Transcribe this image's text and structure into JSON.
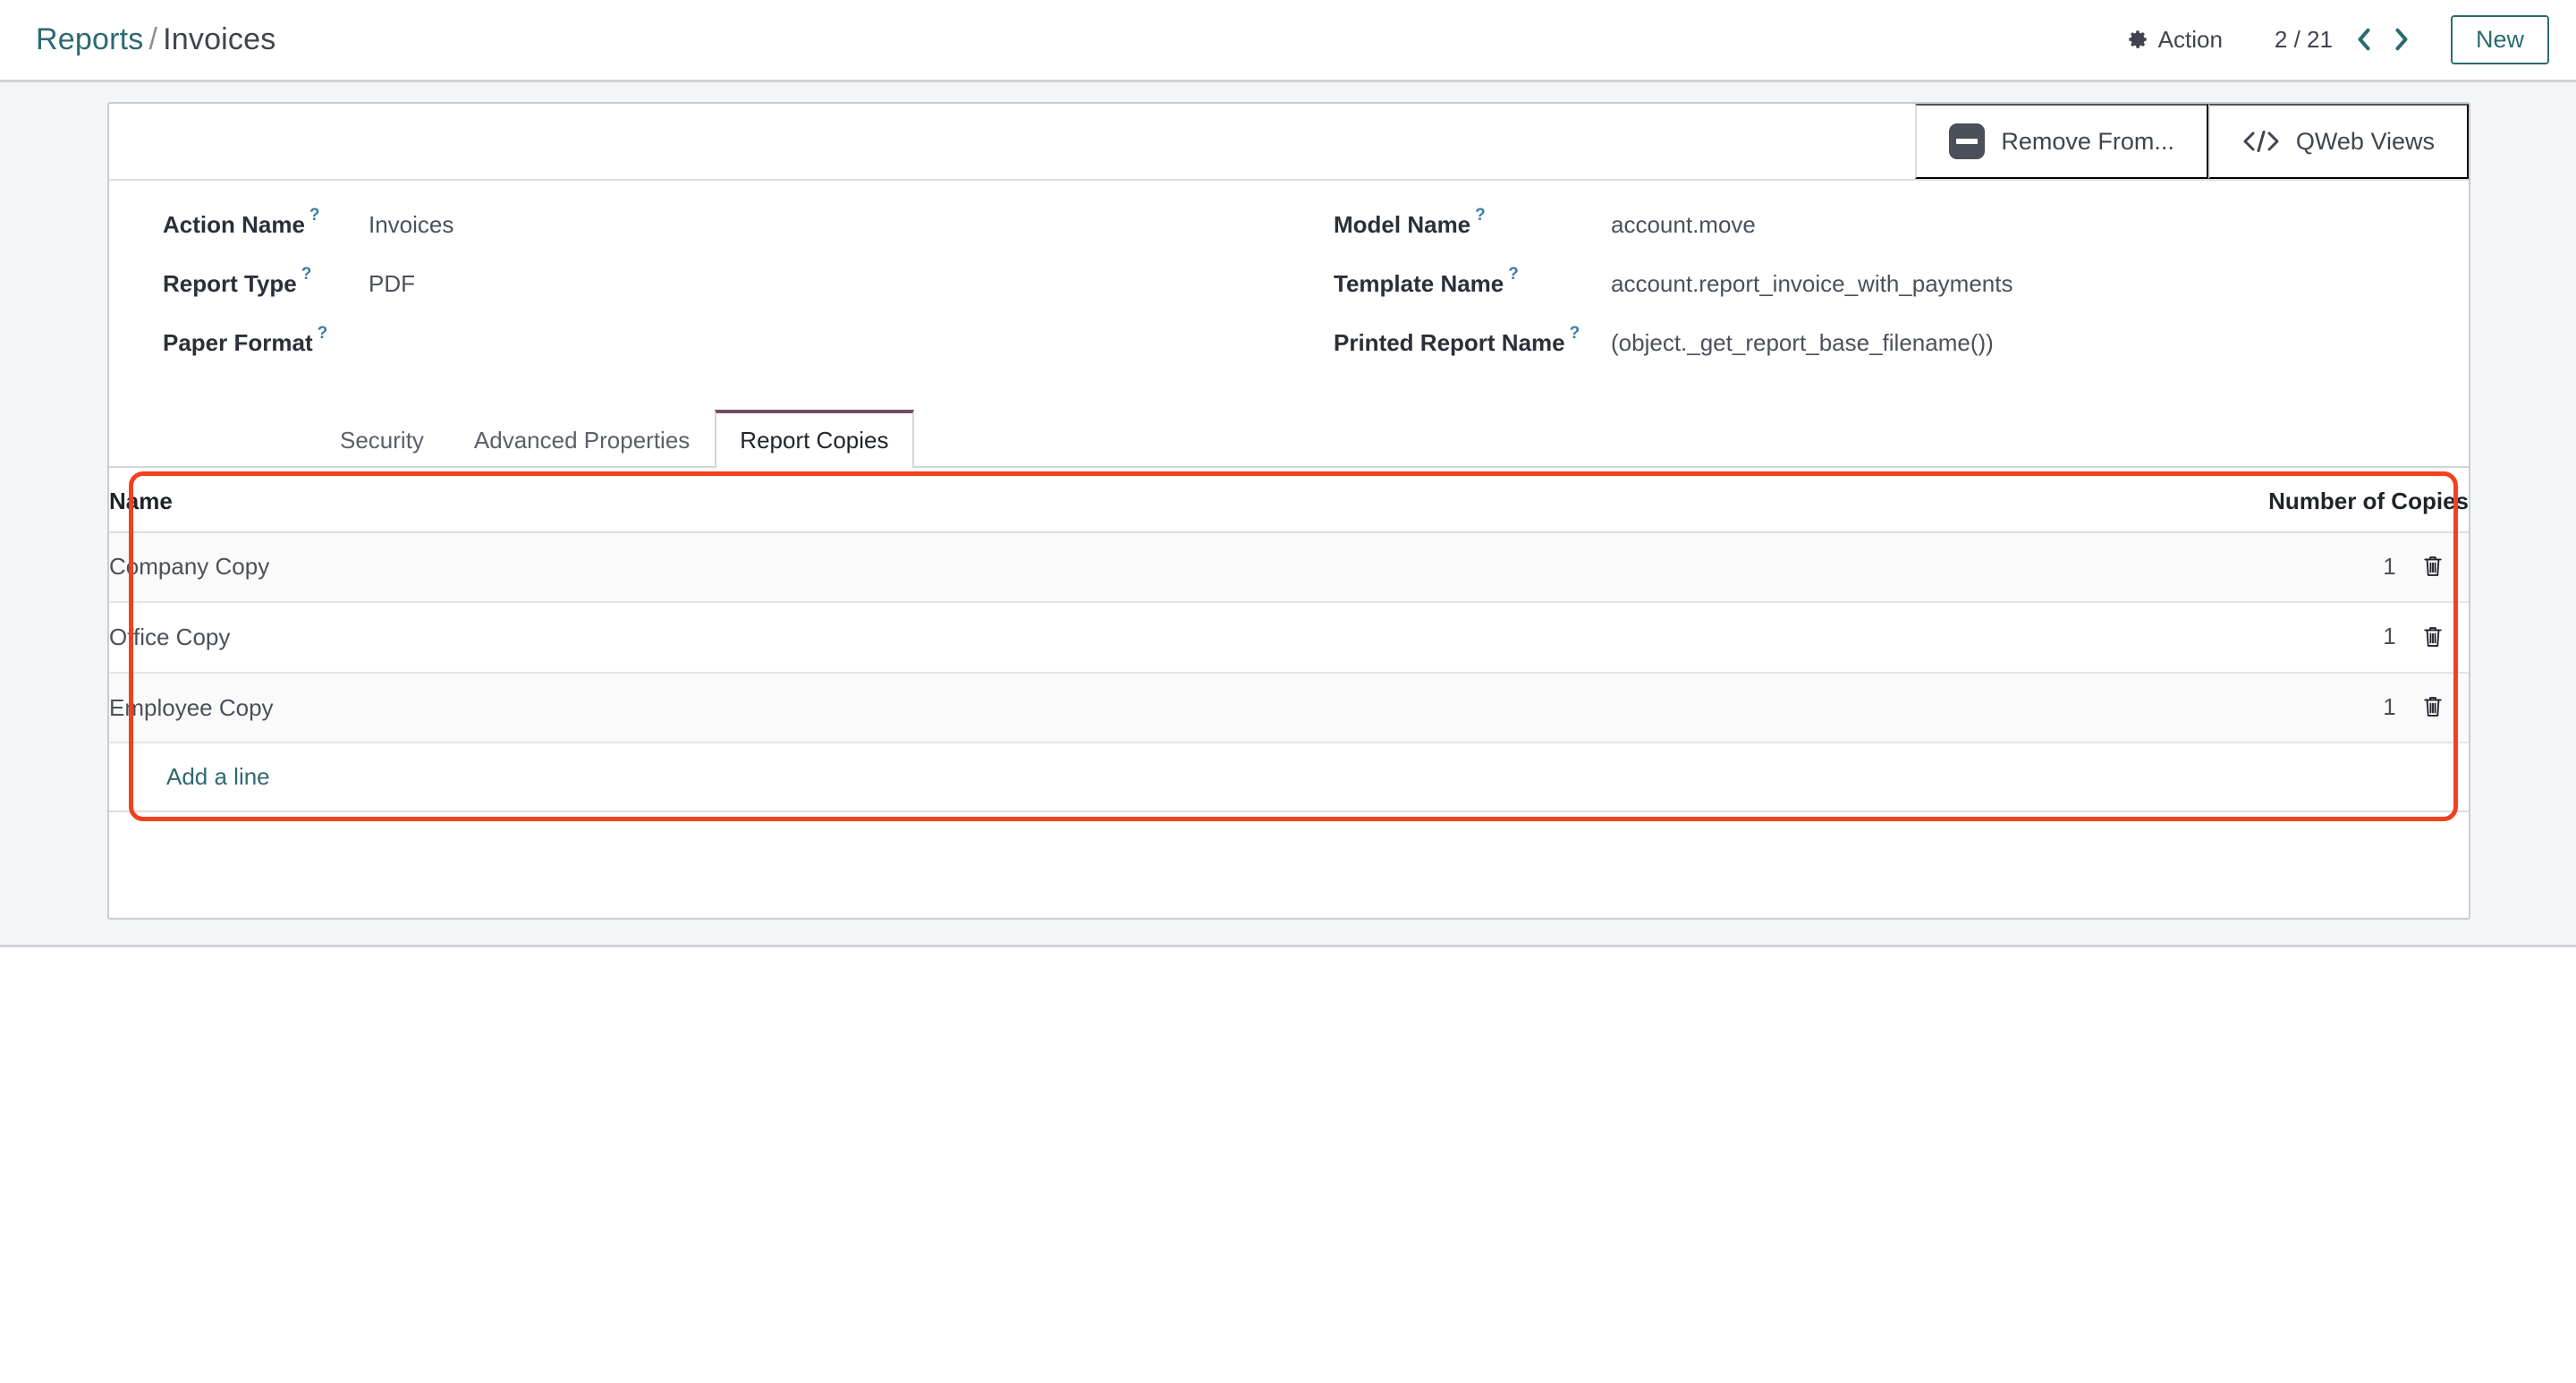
{
  "breadcrumb": {
    "parent": "Reports",
    "separator": "/",
    "current": "Invoices"
  },
  "control_panel": {
    "action_label": "Action",
    "action_icon": "gear-icon",
    "pager_value": "2 / 21",
    "pager_prev_icon": "chevron-left-icon",
    "pager_next_icon": "chevron-right-icon",
    "new_label": "New"
  },
  "stat_buttons": [
    {
      "label": "Remove From...",
      "icon": "minus-square-icon"
    },
    {
      "label": "QWeb Views",
      "icon": "code-icon"
    }
  ],
  "form": {
    "left": [
      {
        "label": "Action Name",
        "help": "?",
        "value": "Invoices"
      },
      {
        "label": "Report Type",
        "help": "?",
        "value": "PDF"
      },
      {
        "label": "Paper Format",
        "help": "?",
        "value": ""
      }
    ],
    "right": [
      {
        "label": "Model Name",
        "help": "?",
        "value": "account.move"
      },
      {
        "label": "Template Name",
        "help": "?",
        "value": "account.report_invoice_with_payments"
      },
      {
        "label": "Printed Report Name",
        "help": "?",
        "value": "(object._get_report_base_filename())"
      }
    ]
  },
  "notebook": {
    "tabs": [
      {
        "label": "Security",
        "active": false
      },
      {
        "label": "Advanced Properties",
        "active": false
      },
      {
        "label": "Report Copies",
        "active": true
      }
    ]
  },
  "report_copies": {
    "columns": {
      "name": "Name",
      "copies": "Number of Copies"
    },
    "rows": [
      {
        "name": "Company Copy",
        "copies": "1",
        "delete_icon": "trash-icon"
      },
      {
        "name": "Office Copy",
        "copies": "1",
        "delete_icon": "trash-icon"
      },
      {
        "name": "Employee Copy",
        "copies": "1",
        "delete_icon": "trash-icon"
      }
    ],
    "add_line_label": "Add a line"
  },
  "colors": {
    "brand_teal": "#2d6a71",
    "brand_purple": "#714b67",
    "annotation_red": "#f2411f",
    "page_bg": "#f4f5f8",
    "help_blue": "#3a7ca5"
  }
}
